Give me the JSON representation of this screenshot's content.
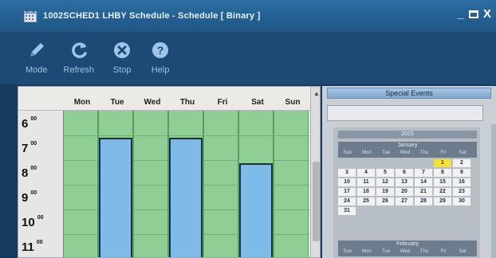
{
  "window": {
    "title": "1002SCHED1 LHBY Schedule - Schedule [ Binary ]",
    "minimize": "_",
    "close": "X"
  },
  "toolbar": {
    "mode_label": "Mode",
    "refresh_label": "Refresh",
    "stop_label": "Stop",
    "help_label": "Help"
  },
  "schedule": {
    "days": [
      "Mon",
      "Tue",
      "Wed",
      "Thu",
      "Fri",
      "Sat",
      "Sun"
    ],
    "hours": [
      "6",
      "7",
      "8",
      "9",
      "10",
      "11"
    ],
    "minutes": "00"
  },
  "special_events": {
    "header": "Special Events",
    "year": "2015",
    "month1": "January",
    "month2": "February",
    "dows": [
      "Sun",
      "Mon",
      "Tue",
      "Wed",
      "Thu",
      "Fri",
      "Sat"
    ],
    "days": [
      "1",
      "2",
      "3",
      "4",
      "5",
      "6",
      "7",
      "8",
      "9",
      "10",
      "11",
      "12",
      "13",
      "14",
      "15",
      "16",
      "17",
      "18",
      "19",
      "20",
      "21",
      "22",
      "23",
      "24",
      "25",
      "26",
      "27",
      "28",
      "29",
      "30",
      "31"
    ],
    "highlighted_day": "1"
  },
  "colors": {
    "off": "#8fcf95",
    "on": "#7fbbe8",
    "highlight": "#f4e23a"
  }
}
